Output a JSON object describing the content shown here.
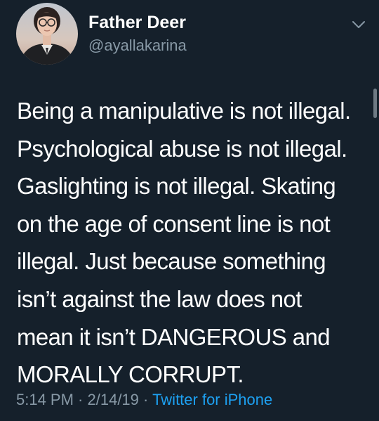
{
  "user": {
    "display_name": "Father Deer",
    "handle": "@ayallakarina"
  },
  "tweet": {
    "lines": [
      "Being a manipulative is not illegal.",
      "Psychological abuse is not illegal.",
      "Gaslighting is not illegal. Skating",
      "on the age of consent line is not",
      "illegal. Just because something",
      "isn’t against the law does not",
      "mean it isn’t DANGEROUS and",
      "MORALLY CORRUPT."
    ]
  },
  "meta": {
    "time": "5:14 PM",
    "separator": " · ",
    "date": "2/14/19",
    "source": "Twitter for iPhone"
  },
  "icons": {
    "menu": "chevron-down-icon"
  },
  "colors": {
    "background": "#15202b",
    "text": "#ffffff",
    "secondary_text": "#8899a6",
    "link": "#1da1f2"
  }
}
